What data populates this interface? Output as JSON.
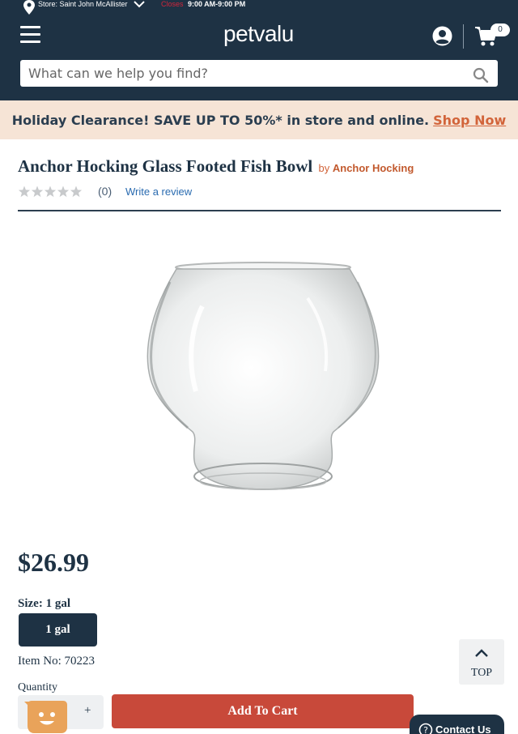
{
  "header": {
    "store_label": "Store: Saint John McAllister",
    "store_status": "Closes",
    "store_hours": "9:00 AM-9:00 PM",
    "logo_text_pet": "pet",
    "logo_text_valu": "valu",
    "cart_count": "0",
    "search_placeholder": "What can we help you find?",
    "icons": [
      "location-pin-icon",
      "chevron-down-icon",
      "hamburger-menu-icon",
      "account-icon",
      "cart-icon",
      "search-icon"
    ]
  },
  "promo": {
    "text": "Holiday Clearance! SAVE UP TO 50%* in store and online.",
    "link": "Shop Now",
    "link_color": "#d2643a",
    "background": "#f6e4d6"
  },
  "product": {
    "title": "Anchor Hocking Glass Footed Fish Bowl",
    "by_label": "by",
    "brand": "Anchor Hocking",
    "rating_stars": 0,
    "rating_max": 5,
    "review_count": "(0)",
    "write_review": "Write a review",
    "price": "$26.99",
    "size_label": "Size: 1 gal",
    "size_option": "1 gal",
    "item_no": "Item No: 70223",
    "quantity_label": "Quantity",
    "quantity_plus": "+",
    "add_to_cart": "Add To Cart"
  },
  "utility": {
    "top_label": "TOP",
    "contact_label": "Contact Us"
  },
  "colors": {
    "header_bg": "#1e3244",
    "accent": "#c8493a",
    "link_blue": "#2a6bb0"
  }
}
